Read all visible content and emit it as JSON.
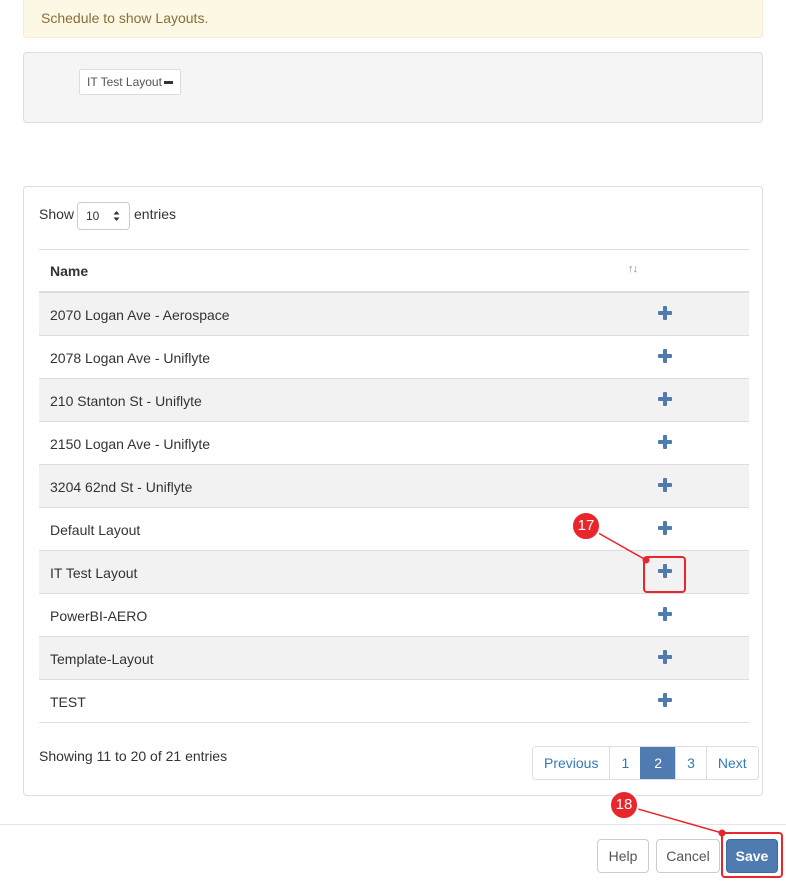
{
  "alert": {
    "text": "Schedule to show Layouts."
  },
  "selected_layouts": [
    {
      "label": "IT Test Layout"
    }
  ],
  "table_controls": {
    "show_label": "Show",
    "page_length": "10",
    "entries_label": "entries"
  },
  "table": {
    "column_name": "Name",
    "sort_icon": "↑↓",
    "rows": [
      {
        "name": "2070 Logan Ave - Aerospace"
      },
      {
        "name": "2078 Logan Ave - Uniflyte"
      },
      {
        "name": "210 Stanton St - Uniflyte"
      },
      {
        "name": "2150 Logan Ave - Uniflyte"
      },
      {
        "name": "3204 62nd St - Uniflyte"
      },
      {
        "name": "Default Layout"
      },
      {
        "name": "IT Test Layout"
      },
      {
        "name": "PowerBI-AERO"
      },
      {
        "name": "Template-Layout"
      },
      {
        "name": "TEST"
      }
    ],
    "row_action_icon": "plus-icon"
  },
  "info_text": "Showing 11 to 20 of 21 entries",
  "pagination": {
    "previous": "Previous",
    "pages": [
      "1",
      "2",
      "3"
    ],
    "current": "2",
    "next": "Next"
  },
  "footer": {
    "help": "Help",
    "cancel": "Cancel",
    "save": "Save"
  },
  "annotations": [
    {
      "label": "17"
    },
    {
      "label": "18"
    }
  ],
  "colors": {
    "accent": "#4f7bb0",
    "annotation_red": "#e8262b",
    "alert_bg": "#fcf8e3",
    "alert_text": "#8a6d3b"
  }
}
